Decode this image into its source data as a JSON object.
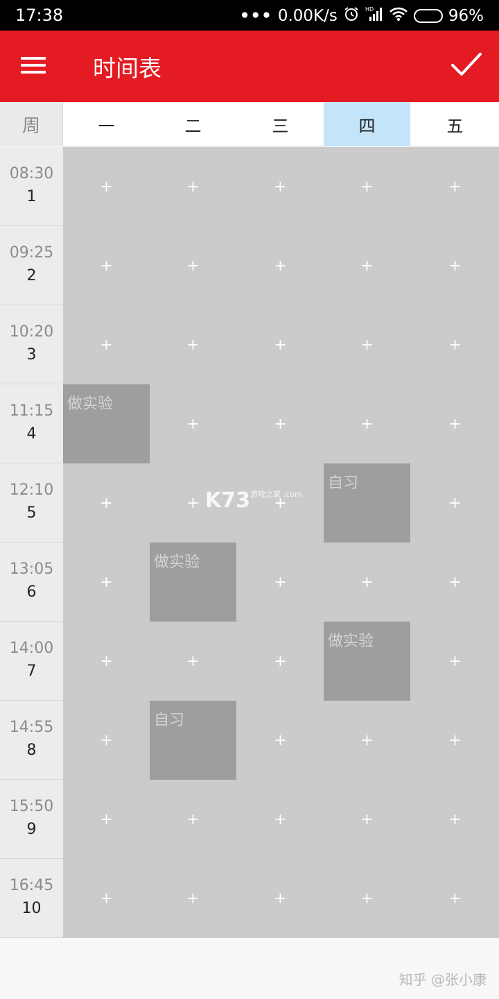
{
  "status_bar": {
    "time": "17:38",
    "dots": "•••",
    "net_speed": "0.00K/s",
    "battery": "96%",
    "battery_level": 0.96,
    "icons": [
      "alarm-icon",
      "hd-signal-icon",
      "wifi-icon",
      "battery-icon"
    ]
  },
  "app_bar": {
    "title": "时间表",
    "menu_icon": "hamburger-menu-icon",
    "confirm_icon": "check-icon",
    "color": "#e41b23"
  },
  "header": {
    "corner": "周",
    "days": [
      "一",
      "二",
      "三",
      "四",
      "五"
    ],
    "today_index": 3,
    "today_color": "#c4e5f9"
  },
  "periods": [
    {
      "time": "08:30",
      "num": "1"
    },
    {
      "time": "09:25",
      "num": "2"
    },
    {
      "time": "10:20",
      "num": "3"
    },
    {
      "time": "11:15",
      "num": "4"
    },
    {
      "time": "12:10",
      "num": "5"
    },
    {
      "time": "13:05",
      "num": "6"
    },
    {
      "time": "14:00",
      "num": "7"
    },
    {
      "time": "14:55",
      "num": "8"
    },
    {
      "time": "15:50",
      "num": "9"
    },
    {
      "time": "16:45",
      "num": "10"
    }
  ],
  "courses": [
    {
      "name": "做实验",
      "day": 0,
      "period": 3
    },
    {
      "name": "自习",
      "day": 3,
      "period": 4
    },
    {
      "name": "做实验",
      "day": 1,
      "period": 5
    },
    {
      "name": "做实验",
      "day": 3,
      "period": 6
    },
    {
      "name": "自习",
      "day": 1,
      "period": 7
    }
  ],
  "add_symbol": "+",
  "watermark": {
    "text": "K73",
    "sub": "游戏之家 .com"
  },
  "footer": {
    "credit": "知乎 @张小康"
  }
}
